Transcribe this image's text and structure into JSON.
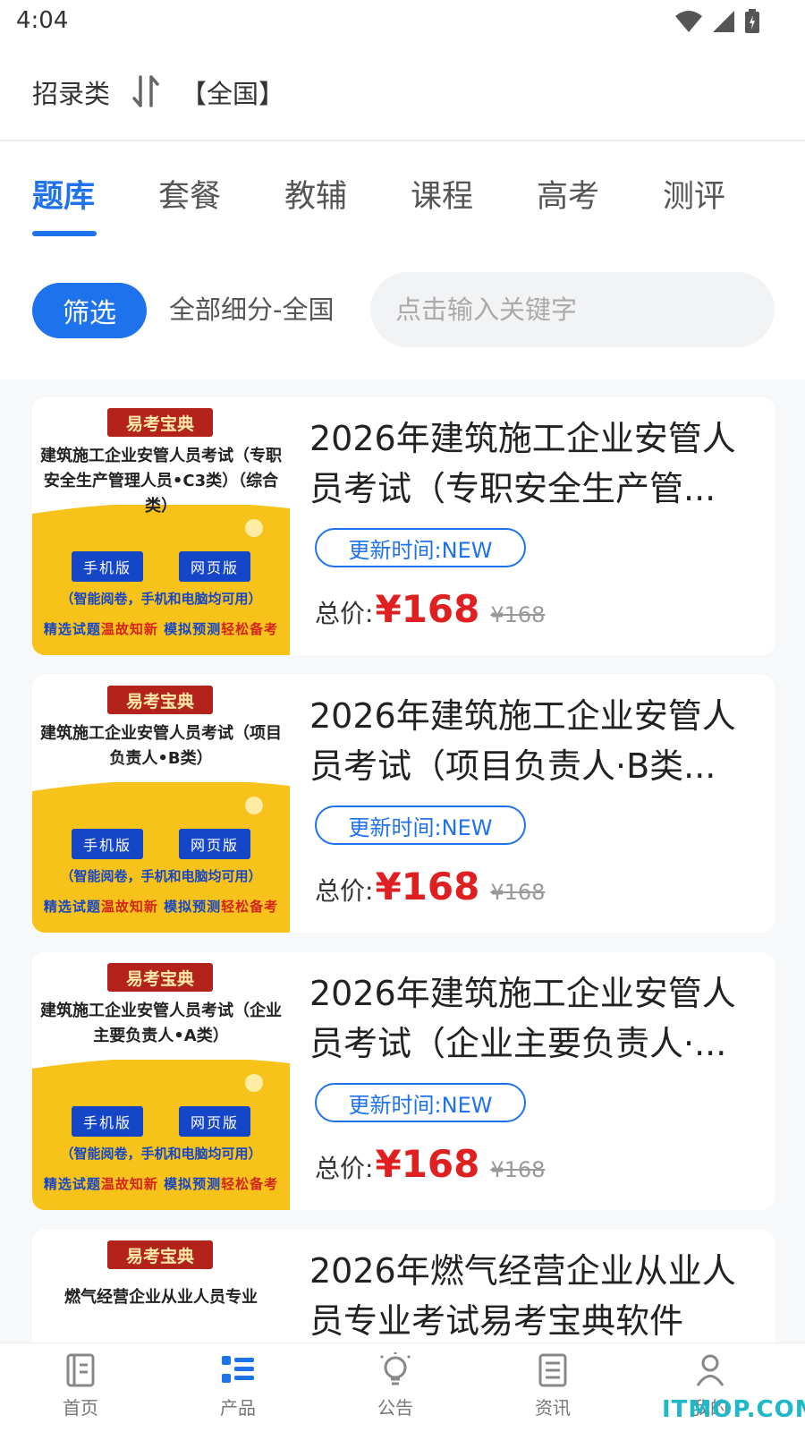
{
  "status_bar": {
    "time": "4:04"
  },
  "header": {
    "category": "招录类",
    "region": "【全国】"
  },
  "tabs": [
    {
      "label": "题库",
      "active": true
    },
    {
      "label": "套餐"
    },
    {
      "label": "教辅"
    },
    {
      "label": "课程"
    },
    {
      "label": "高考"
    },
    {
      "label": "测评"
    }
  ],
  "filter": {
    "button_label": "筛选",
    "scope_label": "全部细分-全国",
    "search_placeholder": "点击输入关键字"
  },
  "products": [
    {
      "cover": {
        "brand": "易考宝典",
        "title": "建筑施工企业安管人员考试（专职安全生产管理人员•C3类）（综合类）",
        "mobile": "手机版",
        "web": "网页版",
        "note": "（智能阅卷，手机和电脑均可用）",
        "slogan_1": "精选试题",
        "slogan_2": "温故知新",
        "slogan_3": "模拟预测",
        "slogan_4": "轻松备考"
      },
      "title": "2026年建筑施工企业安管人员考试（专职安全生产管...",
      "update": "更新时间:NEW",
      "price_label": "总价:",
      "price": "¥168",
      "original_price": "¥168"
    },
    {
      "cover": {
        "brand": "易考宝典",
        "title": "建筑施工企业安管人员考试（项目负责人•B类）",
        "mobile": "手机版",
        "web": "网页版",
        "note": "（智能阅卷，手机和电脑均可用）",
        "slogan_1": "精选试题",
        "slogan_2": "温故知新",
        "slogan_3": "模拟预测",
        "slogan_4": "轻松备考"
      },
      "title": "2026年建筑施工企业安管人员考试（项目负责人·B类...",
      "update": "更新时间:NEW",
      "price_label": "总价:",
      "price": "¥168",
      "original_price": "¥168"
    },
    {
      "cover": {
        "brand": "易考宝典",
        "title": "建筑施工企业安管人员考试（企业主要负责人•A类）",
        "mobile": "手机版",
        "web": "网页版",
        "note": "（智能阅卷，手机和电脑均可用）",
        "slogan_1": "精选试题",
        "slogan_2": "温故知新",
        "slogan_3": "模拟预测",
        "slogan_4": "轻松备考"
      },
      "title": "2026年建筑施工企业安管人员考试（企业主要负责人·...",
      "update": "更新时间:NEW",
      "price_label": "总价:",
      "price": "¥168",
      "original_price": "¥168"
    },
    {
      "cover": {
        "brand": "易考宝典",
        "title": "燃气经营企业从业人员专业"
      },
      "title": "2026年燃气经营企业从业人员专业考试易考宝典软件"
    }
  ],
  "bottom_nav": [
    {
      "label": "首页",
      "icon": "home-icon"
    },
    {
      "label": "产品",
      "icon": "product-list-icon",
      "active": true
    },
    {
      "label": "公告",
      "icon": "bulb-icon"
    },
    {
      "label": "资讯",
      "icon": "news-icon"
    },
    {
      "label": "我的",
      "icon": "user-icon"
    }
  ],
  "watermark": "ITMOP.COM",
  "colors": {
    "accent": "#1e73ec",
    "price": "#e02020",
    "cover_yellow": "#f7c21a",
    "brand_red": "#b3231b"
  }
}
